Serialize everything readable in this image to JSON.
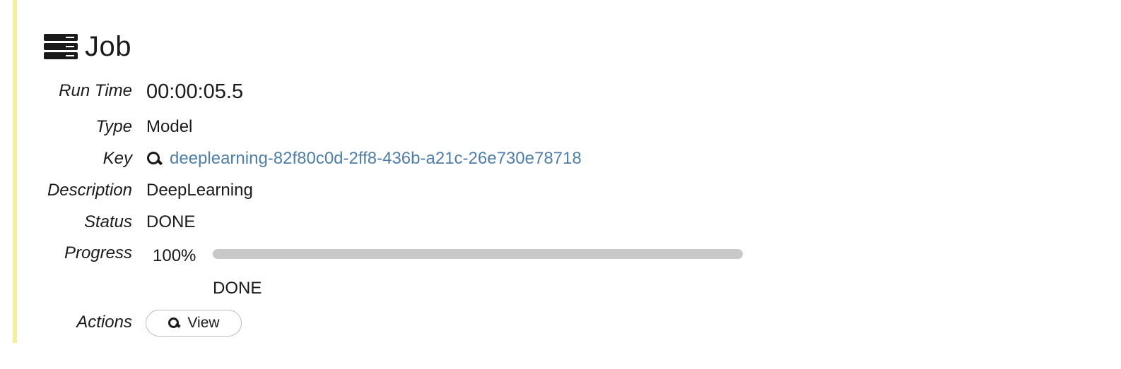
{
  "job": {
    "title": "Job",
    "icon": "server-icon"
  },
  "fields": {
    "run_time": {
      "label": "Run Time",
      "value": "00:00:05.5"
    },
    "type": {
      "label": "Type",
      "value": "Model"
    },
    "key": {
      "label": "Key",
      "value": "deeplearning-82f80c0d-2ff8-436b-a21c-26e730e78718",
      "icon": "search-icon"
    },
    "description": {
      "label": "Description",
      "value": "DeepLearning"
    },
    "status": {
      "label": "Status",
      "value": "DONE"
    },
    "progress": {
      "label": "Progress",
      "percent_text": "100%",
      "fraction": 1.0,
      "status_text": "DONE"
    },
    "actions": {
      "label": "Actions",
      "view_button_label": "View",
      "icon": "search-icon"
    }
  },
  "colors": {
    "accent_bar": "#f3ef9c",
    "link": "#4f7ea6",
    "progress_fill": "#c8c8c8"
  }
}
